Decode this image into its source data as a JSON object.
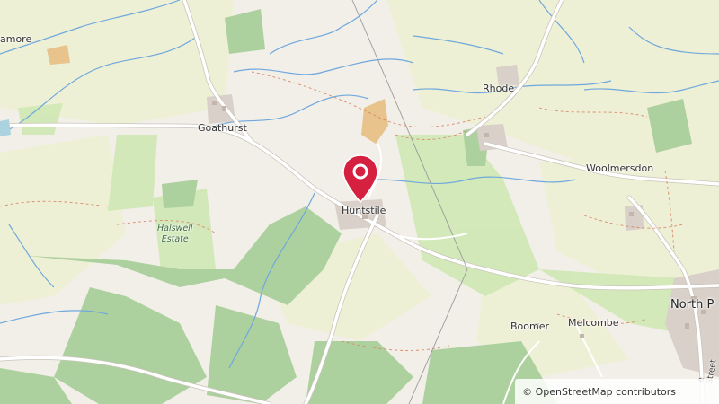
{
  "map": {
    "places": {
      "amore": "amore",
      "goathurst": "Goathurst",
      "rhode": "Rhode",
      "woolmersdon": "Woolmersdon",
      "huntstile": "Huntstile",
      "halswell_line1": "Halswell",
      "halswell_line2": "Estate",
      "north_p": "North P",
      "boomer": "Boomer",
      "melcombe": "Melcombe",
      "street": "e Street"
    },
    "marker": {
      "name": "Huntstile",
      "color": "#d6203f"
    },
    "attribution": "© OpenStreetMap contributors",
    "colors": {
      "background": "#f2efe9",
      "farmland": "#eef0d5",
      "grass": "#cfe8b4",
      "wood": "#add19e",
      "water": "#6fa8dc",
      "road": "#ffffff",
      "path": "#d98a6a"
    }
  }
}
